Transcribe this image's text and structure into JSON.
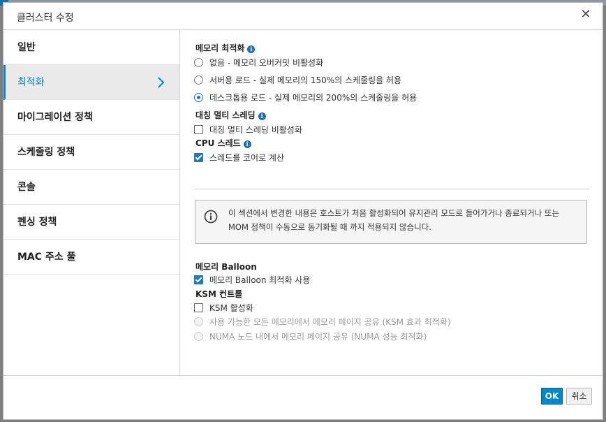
{
  "dialog": {
    "title": "클러스터 수정",
    "close_icon": "close-icon"
  },
  "sidebar": {
    "items": [
      {
        "label": "일반",
        "active": false
      },
      {
        "label": "최적화",
        "active": true
      },
      {
        "label": "마이그레이션 정책",
        "active": false
      },
      {
        "label": "스케줄링 정책",
        "active": false
      },
      {
        "label": "콘솔",
        "active": false
      },
      {
        "label": "펜싱 정책",
        "active": false
      },
      {
        "label": "MAC 주소 풀",
        "active": false
      }
    ]
  },
  "optimization": {
    "memory_opt_label": "메모리 최적화",
    "memory_opt_options": [
      {
        "label": "없음 - 메모리 오버커밋 비활성화",
        "checked": false
      },
      {
        "label": "서버용 로드 - 실제 메모리의 150%의 스케줄링을 허용",
        "checked": false
      },
      {
        "label": "데스크톱용 로드 - 실제 메모리의 200%의 스케줄링을 허용",
        "checked": true
      }
    ],
    "smt_label": "대칭 멀티 스레딩",
    "smt_option": {
      "label": "대칭 멀티 스레딩 비활성화",
      "checked": false
    },
    "cpu_threads_label": "CPU 스레드",
    "cpu_threads_option": {
      "label": "스레드를 코어로 계산",
      "checked": true
    },
    "alert_text": "이 섹션에서 변경한 내용은 호스트가 처음 활성화되어 유지관리 모드로 들어가거나 종료되거나 또는 MOM 정책이 수동으로 동기화될 때 까지 적용되지 않습니다.",
    "balloon_label": "메모리 Balloon",
    "balloon_option": {
      "label": "메모리 Balloon 최적화 사용",
      "checked": true
    },
    "ksm_label": "KSM 컨트롤",
    "ksm_option": {
      "label": "KSM 활성화",
      "checked": false
    },
    "ksm_sub_options": [
      {
        "label": "사용 가능한 모든 메모리에서 메모리 페이지 공유 (KSM 효과 최적화)",
        "disabled": true
      },
      {
        "label": "NUMA 노드 내에서 메모리 페이지 공유 (NUMA 성능 최적화)",
        "disabled": true
      }
    ]
  },
  "footer": {
    "ok_label": "OK",
    "cancel_label": "취소"
  },
  "colors": {
    "accent": "#0088ce",
    "info_icon": "#1e70b7"
  }
}
